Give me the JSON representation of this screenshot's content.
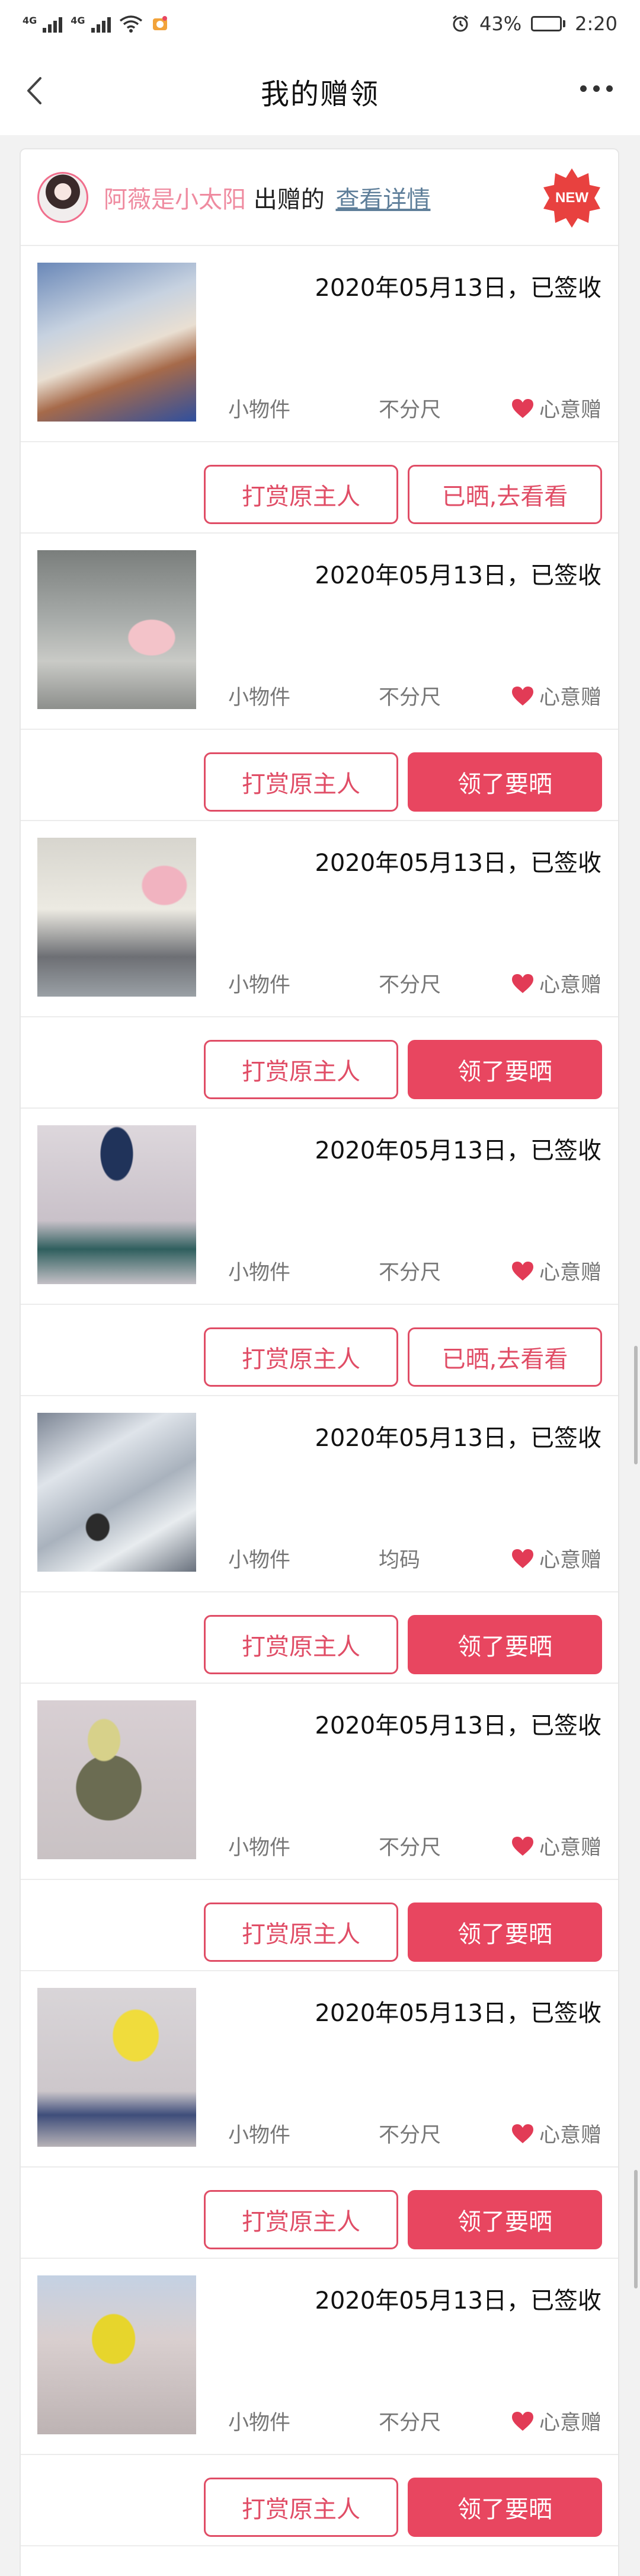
{
  "status_bar": {
    "net_left": "4G",
    "net_right": "4G",
    "alarm_icon": "alarm-clock-icon",
    "battery": "43%",
    "battery_level": 0.43,
    "time": "2:20"
  },
  "nav": {
    "title": "我的赠领",
    "back_icon": "chevron-left-icon",
    "more_icon": "more-dots-icon"
  },
  "card_header": {
    "giver": "阿薇是小太阳",
    "action": " 出赠的 ",
    "link": "查看详情",
    "badge": "NEW"
  },
  "colors": {
    "accent": "#e84660",
    "giver_pink": "#ef8ba0",
    "link_blue": "#5f7f9a"
  },
  "items": [
    {
      "date": "2020年05月13日，已签收",
      "category": "小物件",
      "size": "不分尺",
      "gift": "心意赠",
      "reward": "打赏原主人",
      "action": "已晒,去看看",
      "action_filled": false
    },
    {
      "date": "2020年05月13日，已签收",
      "category": "小物件",
      "size": "不分尺",
      "gift": "心意赠",
      "reward": "打赏原主人",
      "action": "领了要晒",
      "action_filled": true
    },
    {
      "date": "2020年05月13日，已签收",
      "category": "小物件",
      "size": "不分尺",
      "gift": "心意赠",
      "reward": "打赏原主人",
      "action": "领了要晒",
      "action_filled": true
    },
    {
      "date": "2020年05月13日，已签收",
      "category": "小物件",
      "size": "不分尺",
      "gift": "心意赠",
      "reward": "打赏原主人",
      "action": "已晒,去看看",
      "action_filled": false
    },
    {
      "date": "2020年05月13日，已签收",
      "category": "小物件",
      "size": "均码",
      "gift": "心意赠",
      "reward": "打赏原主人",
      "action": "领了要晒",
      "action_filled": true
    },
    {
      "date": "2020年05月13日，已签收",
      "category": "小物件",
      "size": "不分尺",
      "gift": "心意赠",
      "reward": "打赏原主人",
      "action": "领了要晒",
      "action_filled": true
    },
    {
      "date": "2020年05月13日，已签收",
      "category": "小物件",
      "size": "不分尺",
      "gift": "心意赠",
      "reward": "打赏原主人",
      "action": "领了要晒",
      "action_filled": true
    },
    {
      "date": "2020年05月13日，已签收",
      "category": "小物件",
      "size": "不分尺",
      "gift": "心意赠",
      "reward": "打赏原主人",
      "action": "领了要晒",
      "action_filled": true
    }
  ]
}
